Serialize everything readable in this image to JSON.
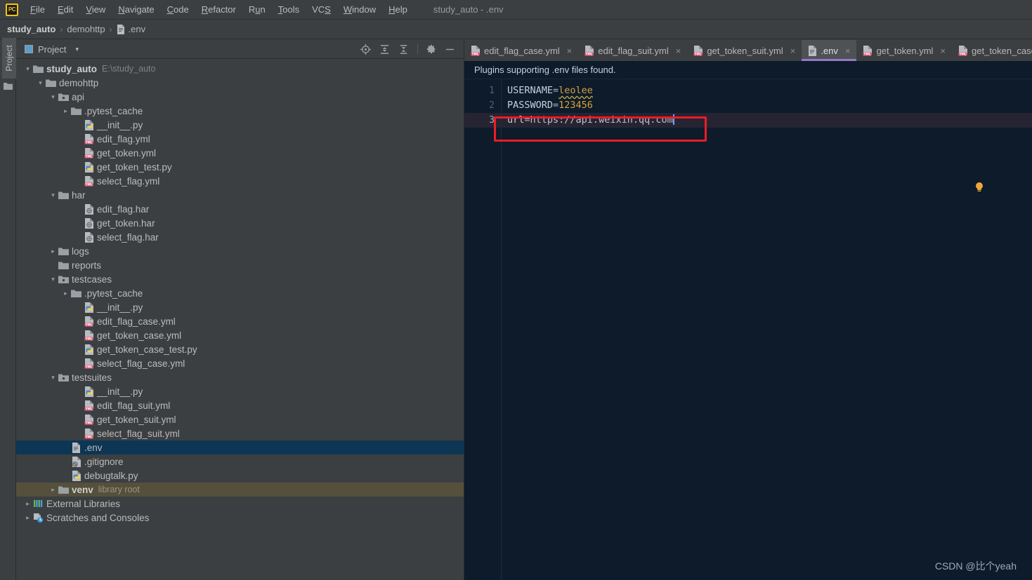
{
  "window": {
    "title": "study_auto - .env",
    "logo_text": "PC"
  },
  "menubar": {
    "items": [
      {
        "label": "File",
        "mnemonic": "F"
      },
      {
        "label": "Edit",
        "mnemonic": "E"
      },
      {
        "label": "View",
        "mnemonic": "V"
      },
      {
        "label": "Navigate",
        "mnemonic": "N"
      },
      {
        "label": "Code",
        "mnemonic": "C"
      },
      {
        "label": "Refactor",
        "mnemonic": "R"
      },
      {
        "label": "Run",
        "mnemonic": "u"
      },
      {
        "label": "Tools",
        "mnemonic": "T"
      },
      {
        "label": "VCS",
        "mnemonic": "S"
      },
      {
        "label": "Window",
        "mnemonic": "W"
      },
      {
        "label": "Help",
        "mnemonic": "H"
      }
    ]
  },
  "breadcrumb": {
    "items": [
      "study_auto",
      "demohttp",
      ".env"
    ],
    "separator": "›"
  },
  "toolstrip": {
    "project_tab_label": "Project",
    "folder_icon": "folder-icon"
  },
  "project_panel": {
    "title": "Project",
    "dropdown_caret": "▾",
    "tools": [
      {
        "name": "locate-in-tree-icon",
        "title": "Select Opened File"
      },
      {
        "name": "expand-all-icon",
        "title": "Expand All"
      },
      {
        "name": "collapse-all-icon",
        "title": "Collapse All"
      },
      {
        "name": "gear-icon",
        "title": "Settings"
      },
      {
        "name": "minimize-icon",
        "title": "Hide"
      }
    ],
    "tree": [
      {
        "indent": 0,
        "arrow": "down",
        "icon": "folder-module-icon",
        "label": "study_auto",
        "bold": true,
        "sub": "E:\\study_auto",
        "state": "normal"
      },
      {
        "indent": 1,
        "arrow": "down",
        "icon": "folder-icon",
        "label": "demohttp",
        "bold": false,
        "sub": "",
        "state": "normal"
      },
      {
        "indent": 2,
        "arrow": "down",
        "icon": "folder-source-icon",
        "label": "api",
        "bold": false,
        "sub": "",
        "state": "normal"
      },
      {
        "indent": 3,
        "arrow": "right",
        "icon": "folder-icon",
        "label": ".pytest_cache",
        "bold": false,
        "sub": "",
        "state": "normal"
      },
      {
        "indent": 4,
        "arrow": "none",
        "icon": "python-icon",
        "label": "__init__.py",
        "bold": false,
        "sub": "",
        "state": "normal"
      },
      {
        "indent": 4,
        "arrow": "none",
        "icon": "yml-icon",
        "label": "edit_flag.yml",
        "bold": false,
        "sub": "",
        "state": "normal"
      },
      {
        "indent": 4,
        "arrow": "none",
        "icon": "yml-icon",
        "label": "get_token.yml",
        "bold": false,
        "sub": "",
        "state": "normal"
      },
      {
        "indent": 4,
        "arrow": "none",
        "icon": "python-icon",
        "label": "get_token_test.py",
        "bold": false,
        "sub": "",
        "state": "normal"
      },
      {
        "indent": 4,
        "arrow": "none",
        "icon": "yml-icon",
        "label": "select_flag.yml",
        "bold": false,
        "sub": "",
        "state": "normal"
      },
      {
        "indent": 2,
        "arrow": "down",
        "icon": "folder-icon",
        "label": "har",
        "bold": false,
        "sub": "",
        "state": "normal"
      },
      {
        "indent": 4,
        "arrow": "none",
        "icon": "har-icon",
        "label": "edit_flag.har",
        "bold": false,
        "sub": "",
        "state": "normal"
      },
      {
        "indent": 4,
        "arrow": "none",
        "icon": "har-icon",
        "label": "get_token.har",
        "bold": false,
        "sub": "",
        "state": "normal"
      },
      {
        "indent": 4,
        "arrow": "none",
        "icon": "har-icon",
        "label": "select_flag.har",
        "bold": false,
        "sub": "",
        "state": "normal"
      },
      {
        "indent": 2,
        "arrow": "right",
        "icon": "folder-icon",
        "label": "logs",
        "bold": false,
        "sub": "",
        "state": "normal"
      },
      {
        "indent": 2,
        "arrow": "none",
        "icon": "folder-icon",
        "label": "reports",
        "bold": false,
        "sub": "",
        "state": "normal"
      },
      {
        "indent": 2,
        "arrow": "down",
        "icon": "folder-source-icon",
        "label": "testcases",
        "bold": false,
        "sub": "",
        "state": "normal"
      },
      {
        "indent": 3,
        "arrow": "right",
        "icon": "folder-icon",
        "label": ".pytest_cache",
        "bold": false,
        "sub": "",
        "state": "normal"
      },
      {
        "indent": 4,
        "arrow": "none",
        "icon": "python-icon",
        "label": "__init__.py",
        "bold": false,
        "sub": "",
        "state": "normal"
      },
      {
        "indent": 4,
        "arrow": "none",
        "icon": "yml-icon",
        "label": "edit_flag_case.yml",
        "bold": false,
        "sub": "",
        "state": "normal"
      },
      {
        "indent": 4,
        "arrow": "none",
        "icon": "yml-icon",
        "label": "get_token_case.yml",
        "bold": false,
        "sub": "",
        "state": "normal"
      },
      {
        "indent": 4,
        "arrow": "none",
        "icon": "python-icon",
        "label": "get_token_case_test.py",
        "bold": false,
        "sub": "",
        "state": "normal"
      },
      {
        "indent": 4,
        "arrow": "none",
        "icon": "yml-icon",
        "label": "select_flag_case.yml",
        "bold": false,
        "sub": "",
        "state": "normal"
      },
      {
        "indent": 2,
        "arrow": "down",
        "icon": "folder-source-icon",
        "label": "testsuites",
        "bold": false,
        "sub": "",
        "state": "normal"
      },
      {
        "indent": 4,
        "arrow": "none",
        "icon": "python-icon",
        "label": "__init__.py",
        "bold": false,
        "sub": "",
        "state": "normal"
      },
      {
        "indent": 4,
        "arrow": "none",
        "icon": "yml-icon",
        "label": "edit_flag_suit.yml",
        "bold": false,
        "sub": "",
        "state": "normal"
      },
      {
        "indent": 4,
        "arrow": "none",
        "icon": "yml-icon",
        "label": "get_token_suit.yml",
        "bold": false,
        "sub": "",
        "state": "normal"
      },
      {
        "indent": 4,
        "arrow": "none",
        "icon": "yml-icon",
        "label": "select_flag_suit.yml",
        "bold": false,
        "sub": "",
        "state": "normal"
      },
      {
        "indent": 3,
        "arrow": "none",
        "icon": "env-icon",
        "label": ".env",
        "bold": false,
        "sub": "",
        "state": "selected"
      },
      {
        "indent": 3,
        "arrow": "none",
        "icon": "gitignore-icon",
        "label": ".gitignore",
        "bold": false,
        "sub": "",
        "state": "normal"
      },
      {
        "indent": 3,
        "arrow": "none",
        "icon": "python-icon",
        "label": "debugtalk.py",
        "bold": false,
        "sub": "",
        "state": "normal"
      },
      {
        "indent": 2,
        "arrow": "right",
        "icon": "folder-icon",
        "label": "venv",
        "bold": true,
        "sub": "library root",
        "state": "venv"
      },
      {
        "indent": 0,
        "arrow": "right",
        "icon": "libraries-icon",
        "label": "External Libraries",
        "bold": false,
        "sub": "",
        "state": "normal"
      },
      {
        "indent": 0,
        "arrow": "right",
        "icon": "scratches-icon",
        "label": "Scratches and Consoles",
        "bold": false,
        "sub": "",
        "state": "normal"
      }
    ]
  },
  "editor": {
    "tabs": [
      {
        "label": "edit_flag_case.yml",
        "icon": "yml-icon",
        "active": false,
        "close": "×"
      },
      {
        "label": "edit_flag_suit.yml",
        "icon": "yml-icon",
        "active": false,
        "close": "×"
      },
      {
        "label": "get_token_suit.yml",
        "icon": "yml-icon",
        "active": false,
        "close": "×"
      },
      {
        "label": ".env",
        "icon": "env-icon",
        "active": true,
        "close": "×"
      },
      {
        "label": "get_token.yml",
        "icon": "yml-icon",
        "active": false,
        "close": "×"
      },
      {
        "label": "get_token_case.yml",
        "icon": "yml-icon",
        "active": false,
        "close": "×"
      }
    ],
    "tab_overflow_icon": "›",
    "notice": "Plugins supporting .env files found.",
    "gutter_lines": [
      "1",
      "2",
      "3"
    ],
    "lines": [
      {
        "num": "1",
        "key": "USERNAME",
        "eq": "=",
        "value": "leolee",
        "value_style": "squiggle",
        "highlight": false
      },
      {
        "num": "2",
        "key": "PASSWORD",
        "eq": "=",
        "value": "123456",
        "value_style": "plain",
        "highlight": false
      },
      {
        "num": "3",
        "key": "url",
        "eq": "=",
        "value": "https://api.weixin.qq.com",
        "value_style": "url",
        "highlight": true
      }
    ],
    "annotation": {
      "name": "red-highlight-box",
      "color": "#ee1c25"
    },
    "bulb_icon": "intention-bulb-icon"
  },
  "watermark": "CSDN @比个yeah",
  "colors": {
    "chrome": "#3c3f41",
    "editor_bg": "#0d1b2a",
    "current_line": "#262433",
    "tree_selected": "#0d3655",
    "tree_venv": "#55503c",
    "tab_active_underline": "#9876c8",
    "annotation_red": "#ee1c25"
  }
}
